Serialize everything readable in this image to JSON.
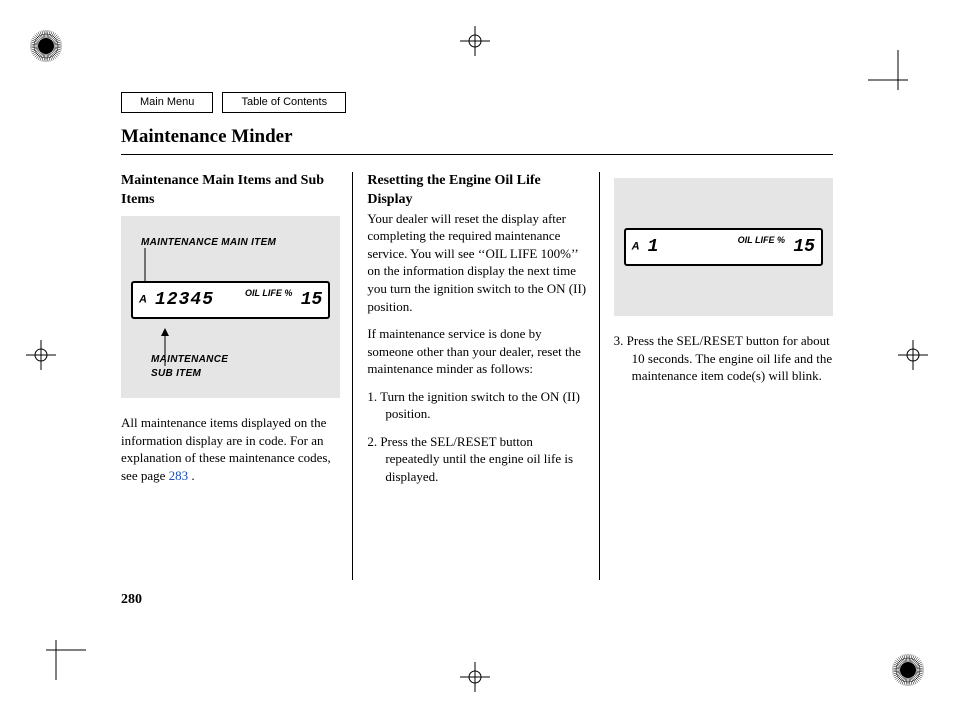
{
  "nav": {
    "main_menu": "Main Menu",
    "toc": "Table of Contents"
  },
  "title": "Maintenance Minder",
  "col1": {
    "heading": "Maintenance Main Items and Sub Items",
    "callout_top": "MAINTENANCE MAIN ITEM",
    "callout_bottom_l1": "MAINTENANCE",
    "callout_bottom_l2": "SUB ITEM",
    "lcd": {
      "a": "A",
      "digits": "12345",
      "oil_label": "OIL LIFE %",
      "pct": "15"
    },
    "para_pre": "All maintenance items displayed on the information display are in code. For an explanation of these maintenance codes, see page ",
    "link_page": "283",
    "para_post": " ."
  },
  "col2": {
    "heading": "Resetting the Engine Oil Life Display",
    "para1": "Your dealer will reset the display after completing the required maintenance service. You will see ‘‘OIL LIFE 100%’’ on the information display the next time you turn the ignition switch to the ON (II) position.",
    "para2": "If maintenance service is done by someone other than your dealer, reset the maintenance minder as follows:",
    "step1": "1. Turn the ignition switch to the ON (II) position.",
    "step2": "2. Press the SEL/RESET button repeatedly until the engine oil life is displayed."
  },
  "col3": {
    "lcd": {
      "a": "A",
      "digits": "1",
      "oil_label": "OIL LIFE %",
      "pct": "15"
    },
    "step3": "3. Press the SEL/RESET button for about 10 seconds. The engine oil life and the maintenance item code(s) will blink."
  },
  "page_number": "280"
}
